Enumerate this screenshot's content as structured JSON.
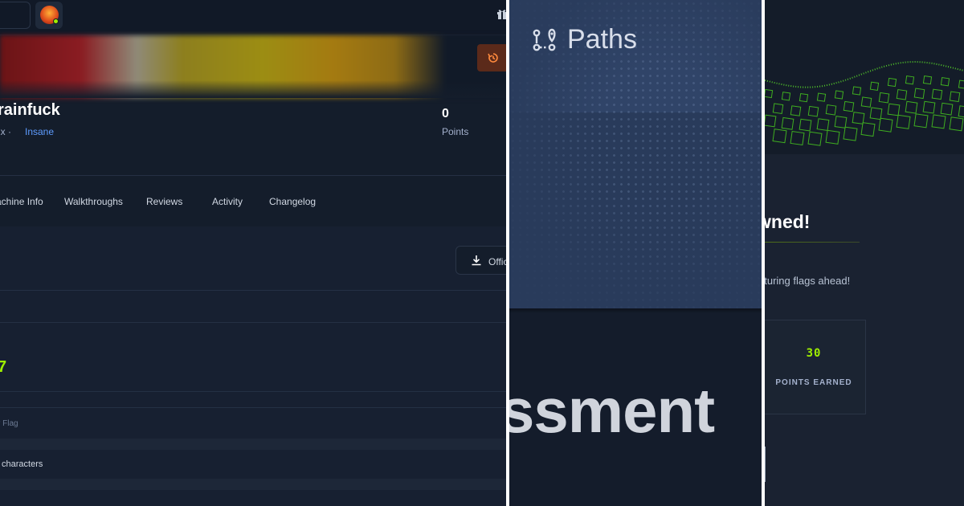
{
  "machine": {
    "name": "rainfuck",
    "os": "ux",
    "os_separator": "·",
    "difficulty": "Insane",
    "points_value": "0",
    "points_label": "Points",
    "tabs": [
      "achine Info",
      "Walkthroughs",
      "Reviews",
      "Activity",
      "Changelog"
    ],
    "official_button_label": "Offic",
    "value_7": "7",
    "flag_label": "r Flag",
    "characters_label": "characters"
  },
  "icons": {
    "history": "history-icon",
    "download": "download-icon",
    "gift": "gift-icon",
    "paths": "paths-icon"
  },
  "paths": {
    "title": "Paths",
    "big_text": "ssment"
  },
  "owned": {
    "heading": "wned!",
    "subtitle": "pturing flags ahead!",
    "points_value": "30",
    "points_label": "POINTS EARNED"
  },
  "colors": {
    "accent_green": "#9fef00",
    "link_blue": "#5e9cff",
    "background": "#141d2b"
  }
}
